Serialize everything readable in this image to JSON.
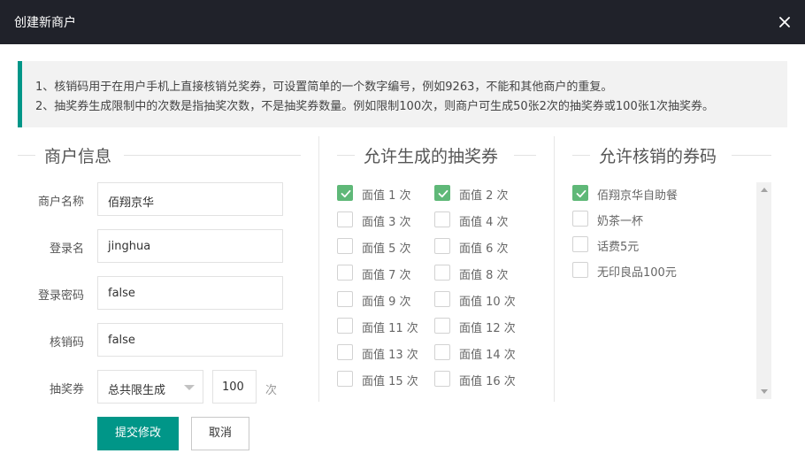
{
  "dialog": {
    "title": "创建新商户"
  },
  "notice": {
    "line1": "1、核销码用于在用户手机上直接核销兑奖券，可设置简单的一个数字编号，例如9263，不能和其他商户的重复。",
    "line2": "2、抽奖券生成限制中的次数是指抽奖次数，不是抽奖券数量。例如限制100次，则商户可生成50张2次的抽奖券或100张1次抽奖券。"
  },
  "merchant": {
    "section_title": "商户信息",
    "name_label": "商户名称",
    "name_value": "佰翔京华",
    "login_label": "登录名",
    "login_value": "jinghua",
    "password_label": "登录密码",
    "password_value": "false",
    "code_label": "核销码",
    "code_value": "false",
    "coupon_label": "抽奖券",
    "limit_mode": "总共限生成",
    "limit_count": "100",
    "limit_unit": "次"
  },
  "actions": {
    "submit": "提交修改",
    "cancel": "取消"
  },
  "coupons": {
    "section_title": "允许生成的抽奖券",
    "items": [
      {
        "label": "面值 1 次",
        "checked": true
      },
      {
        "label": "面值 2 次",
        "checked": true
      },
      {
        "label": "面值 3 次",
        "checked": false
      },
      {
        "label": "面值 4 次",
        "checked": false
      },
      {
        "label": "面值 5 次",
        "checked": false
      },
      {
        "label": "面值 6 次",
        "checked": false
      },
      {
        "label": "面值 7 次",
        "checked": false
      },
      {
        "label": "面值 8 次",
        "checked": false
      },
      {
        "label": "面值 9 次",
        "checked": false
      },
      {
        "label": "面值 10 次",
        "checked": false
      },
      {
        "label": "面值 11 次",
        "checked": false
      },
      {
        "label": "面值 12 次",
        "checked": false
      },
      {
        "label": "面值 13 次",
        "checked": false
      },
      {
        "label": "面值 14 次",
        "checked": false
      },
      {
        "label": "面值 15 次",
        "checked": false
      },
      {
        "label": "面值 16 次",
        "checked": false
      }
    ]
  },
  "codes": {
    "section_title": "允许核销的券码",
    "items": [
      {
        "label": "佰翔京华自助餐",
        "checked": true
      },
      {
        "label": "奶茶一杯",
        "checked": false
      },
      {
        "label": "话费5元",
        "checked": false
      },
      {
        "label": "无印良品100元",
        "checked": false
      }
    ]
  },
  "colors": {
    "accent": "#009688",
    "checked": "#5fb878",
    "titlebar": "#20222a"
  }
}
